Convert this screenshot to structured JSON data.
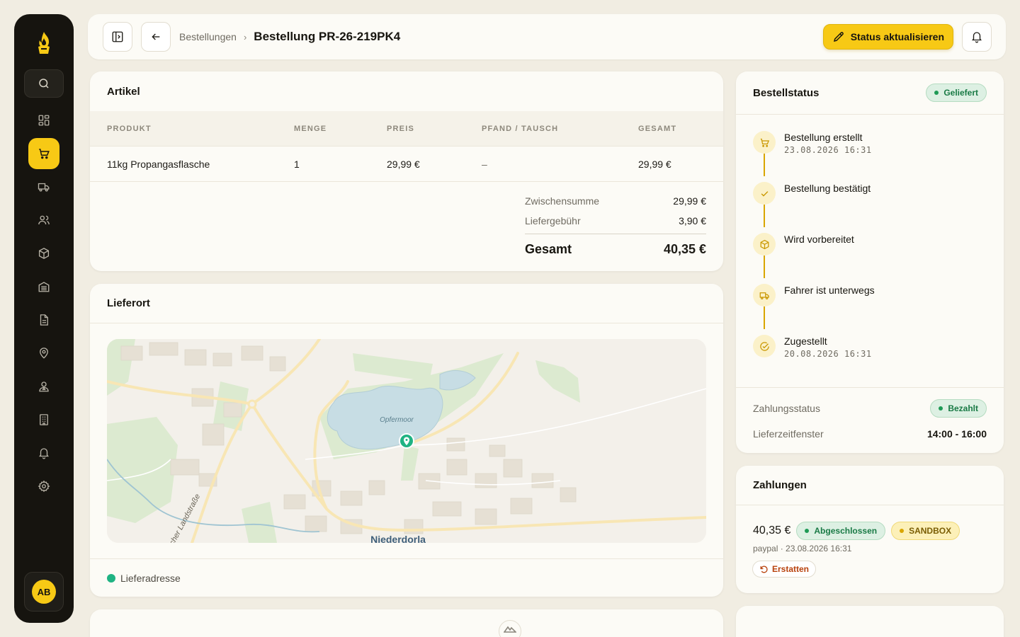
{
  "sidebar": {
    "icons": [
      "dashboard-icon",
      "cart-icon",
      "truck-icon",
      "users-icon",
      "package-icon",
      "warehouse-icon",
      "document-icon",
      "map-pin-icon",
      "driver-icon",
      "building-icon",
      "bell-icon",
      "gear-icon"
    ],
    "active": "cart-icon",
    "user_initials": "AB"
  },
  "header": {
    "breadcrumb_parent": "Bestellungen",
    "breadcrumb_sep": "›",
    "title": "Bestellung PR-26-219PK4",
    "status_button": "Status aktualisieren"
  },
  "articles": {
    "title": "Artikel",
    "columns": [
      "PRODUKT",
      "MENGE",
      "PREIS",
      "PFAND / TAUSCH",
      "GESAMT"
    ],
    "rows": [
      {
        "product": "11kg Propangasflasche",
        "qty": "1",
        "price": "29,99 €",
        "deposit": "–",
        "total": "29,99 €"
      }
    ],
    "subtotal_label": "Zwischensumme",
    "subtotal": "29,99 €",
    "fee_label": "Liefergebühr",
    "fee": "3,90 €",
    "grand_label": "Gesamt",
    "grand_total": "40,35 €"
  },
  "location": {
    "title": "Lieferort",
    "map_labels": {
      "lake": "Opfermoor",
      "town": "Niederdorla",
      "road": "cher Landstraße"
    },
    "legend": "Lieferadresse"
  },
  "order_status": {
    "title": "Bestellstatus",
    "badge": "Geliefert",
    "steps": [
      {
        "label": "Bestellung erstellt",
        "time": "23.08.2026 16:31",
        "icon": "cart-icon"
      },
      {
        "label": "Bestellung bestätigt",
        "time": "",
        "icon": "check-icon"
      },
      {
        "label": "Wird vorbereitet",
        "time": "",
        "icon": "package-icon"
      },
      {
        "label": "Fahrer ist unterwegs",
        "time": "",
        "icon": "truck-icon"
      },
      {
        "label": "Zugestellt",
        "time": "20.08.2026 16:31",
        "icon": "check-circle-icon"
      }
    ],
    "payment_status_label": "Zahlungsstatus",
    "payment_status": "Bezahlt",
    "window_label": "Lieferzeitfenster",
    "window": "14:00 - 16:00"
  },
  "payments": {
    "title": "Zahlungen",
    "amount": "40,35 €",
    "status_badge": "Abgeschlossen",
    "env_badge": "SANDBOX",
    "meta": "paypal · 23.08.2026 16:31",
    "refund_label": "Erstatten"
  },
  "colors": {
    "accent": "#f7c915",
    "sidebar": "#16140f",
    "success": "#1fb383",
    "background": "#f1ede2"
  }
}
